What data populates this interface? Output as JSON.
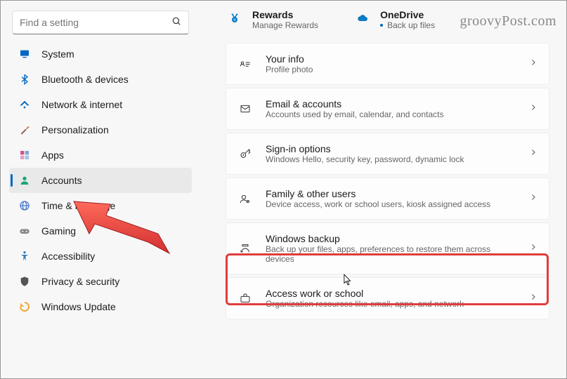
{
  "search": {
    "placeholder": "Find a setting"
  },
  "sidebar": {
    "items": [
      {
        "label": "System",
        "icon": "monitor",
        "color": "#0067c0"
      },
      {
        "label": "Bluetooth & devices",
        "icon": "bluetooth",
        "color": "#0067c0"
      },
      {
        "label": "Network & internet",
        "icon": "wifi",
        "color": "#0067c0"
      },
      {
        "label": "Personalization",
        "icon": "brush",
        "color": "#8b5a44"
      },
      {
        "label": "Apps",
        "icon": "apps",
        "color": "#d64f8f"
      },
      {
        "label": "Accounts",
        "icon": "person",
        "color": "#19a678"
      },
      {
        "label": "Time & language",
        "icon": "globe",
        "color": "#4a7bc8"
      },
      {
        "label": "Gaming",
        "icon": "gamepad",
        "color": "#888"
      },
      {
        "label": "Accessibility",
        "icon": "accessibility",
        "color": "#2a7ab9"
      },
      {
        "label": "Privacy & security",
        "icon": "shield",
        "color": "#555"
      },
      {
        "label": "Windows Update",
        "icon": "update",
        "color": "#f2a93a"
      }
    ]
  },
  "header": {
    "tiles": [
      {
        "title": "Rewards",
        "sub": "Manage Rewards",
        "icon": "medal"
      },
      {
        "title": "OneDrive",
        "sub": "Back up files",
        "icon": "cloud",
        "dot": true
      }
    ]
  },
  "main": {
    "cards": [
      {
        "title": "Your info",
        "sub": "Profile photo",
        "icon": "idcard"
      },
      {
        "title": "Email & accounts",
        "sub": "Accounts used by email, calendar, and contacts",
        "icon": "mail"
      },
      {
        "title": "Sign-in options",
        "sub": "Windows Hello, security key, password, dynamic lock",
        "icon": "key"
      },
      {
        "title": "Family & other users",
        "sub": "Device access, work or school users, kiosk assigned access",
        "icon": "people"
      },
      {
        "title": "Windows backup",
        "sub": "Back up your files, apps, preferences to restore them across devices",
        "icon": "backup"
      },
      {
        "title": "Access work or school",
        "sub": "Organization resources like email, apps, and network",
        "icon": "briefcase"
      }
    ]
  },
  "watermark": "groovyPost.com"
}
